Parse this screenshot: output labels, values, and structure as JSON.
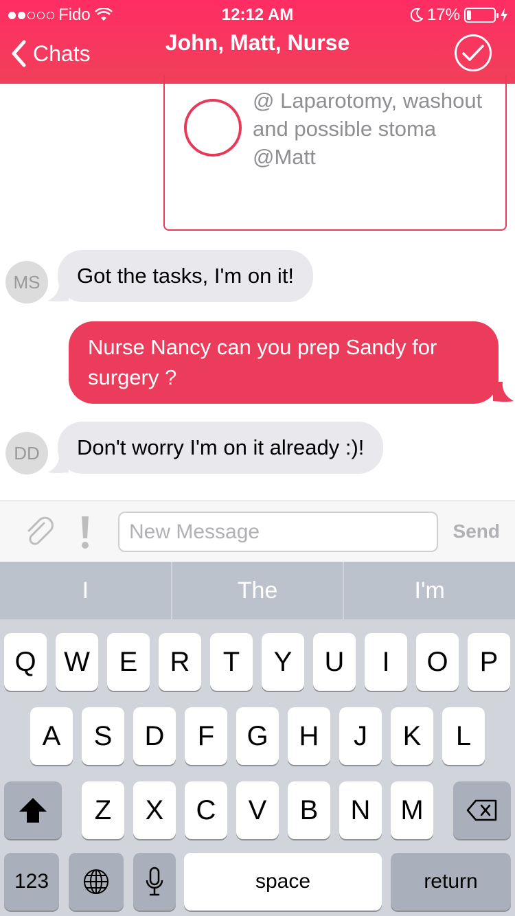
{
  "status_bar": {
    "carrier": "Fido",
    "time": "12:12 AM",
    "battery": "17%",
    "battery_level": 0.17
  },
  "nav": {
    "back_label": "Chats",
    "title": "John, Matt, Nurse"
  },
  "task": {
    "text": "@ Laparotomy, washout and possible stoma @Matt"
  },
  "messages": [
    {
      "direction": "in",
      "avatar": "MS",
      "text": "Got the tasks, I'm on it!"
    },
    {
      "direction": "out",
      "text": "Nurse Nancy can you prep Sandy for surgery ?"
    },
    {
      "direction": "in",
      "avatar": "DD",
      "text": "Don't worry I'm on it already :)!"
    }
  ],
  "composer": {
    "placeholder": "New Message",
    "send_label": "Send"
  },
  "keyboard": {
    "suggestions": [
      "I",
      "The",
      "I'm"
    ],
    "row1": [
      "Q",
      "W",
      "E",
      "R",
      "T",
      "Y",
      "U",
      "I",
      "O",
      "P"
    ],
    "row2": [
      "A",
      "S",
      "D",
      "F",
      "G",
      "H",
      "J",
      "K",
      "L"
    ],
    "row3": [
      "Z",
      "X",
      "C",
      "V",
      "B",
      "N",
      "M"
    ],
    "numbers_label": "123",
    "space_label": "space",
    "return_label": "return"
  }
}
